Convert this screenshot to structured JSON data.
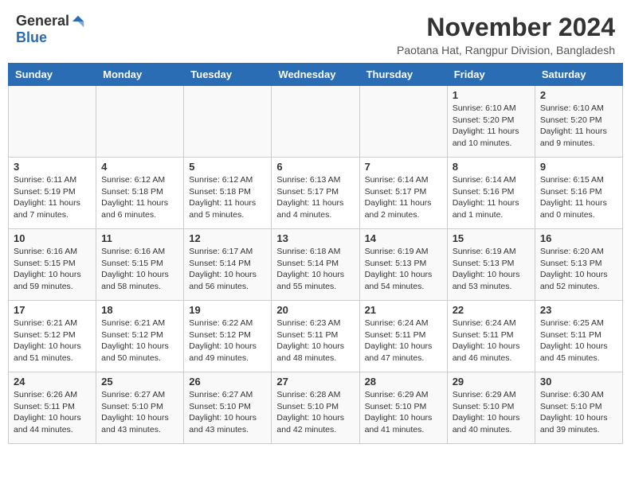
{
  "logo": {
    "general": "General",
    "blue": "Blue"
  },
  "header": {
    "month_title": "November 2024",
    "location": "Paotana Hat, Rangpur Division, Bangladesh"
  },
  "weekdays": [
    "Sunday",
    "Monday",
    "Tuesday",
    "Wednesday",
    "Thursday",
    "Friday",
    "Saturday"
  ],
  "weeks": [
    [
      {
        "day": "",
        "info": ""
      },
      {
        "day": "",
        "info": ""
      },
      {
        "day": "",
        "info": ""
      },
      {
        "day": "",
        "info": ""
      },
      {
        "day": "",
        "info": ""
      },
      {
        "day": "1",
        "info": "Sunrise: 6:10 AM\nSunset: 5:20 PM\nDaylight: 11 hours and 10 minutes."
      },
      {
        "day": "2",
        "info": "Sunrise: 6:10 AM\nSunset: 5:20 PM\nDaylight: 11 hours and 9 minutes."
      }
    ],
    [
      {
        "day": "3",
        "info": "Sunrise: 6:11 AM\nSunset: 5:19 PM\nDaylight: 11 hours and 7 minutes."
      },
      {
        "day": "4",
        "info": "Sunrise: 6:12 AM\nSunset: 5:18 PM\nDaylight: 11 hours and 6 minutes."
      },
      {
        "day": "5",
        "info": "Sunrise: 6:12 AM\nSunset: 5:18 PM\nDaylight: 11 hours and 5 minutes."
      },
      {
        "day": "6",
        "info": "Sunrise: 6:13 AM\nSunset: 5:17 PM\nDaylight: 11 hours and 4 minutes."
      },
      {
        "day": "7",
        "info": "Sunrise: 6:14 AM\nSunset: 5:17 PM\nDaylight: 11 hours and 2 minutes."
      },
      {
        "day": "8",
        "info": "Sunrise: 6:14 AM\nSunset: 5:16 PM\nDaylight: 11 hours and 1 minute."
      },
      {
        "day": "9",
        "info": "Sunrise: 6:15 AM\nSunset: 5:16 PM\nDaylight: 11 hours and 0 minutes."
      }
    ],
    [
      {
        "day": "10",
        "info": "Sunrise: 6:16 AM\nSunset: 5:15 PM\nDaylight: 10 hours and 59 minutes."
      },
      {
        "day": "11",
        "info": "Sunrise: 6:16 AM\nSunset: 5:15 PM\nDaylight: 10 hours and 58 minutes."
      },
      {
        "day": "12",
        "info": "Sunrise: 6:17 AM\nSunset: 5:14 PM\nDaylight: 10 hours and 56 minutes."
      },
      {
        "day": "13",
        "info": "Sunrise: 6:18 AM\nSunset: 5:14 PM\nDaylight: 10 hours and 55 minutes."
      },
      {
        "day": "14",
        "info": "Sunrise: 6:19 AM\nSunset: 5:13 PM\nDaylight: 10 hours and 54 minutes."
      },
      {
        "day": "15",
        "info": "Sunrise: 6:19 AM\nSunset: 5:13 PM\nDaylight: 10 hours and 53 minutes."
      },
      {
        "day": "16",
        "info": "Sunrise: 6:20 AM\nSunset: 5:13 PM\nDaylight: 10 hours and 52 minutes."
      }
    ],
    [
      {
        "day": "17",
        "info": "Sunrise: 6:21 AM\nSunset: 5:12 PM\nDaylight: 10 hours and 51 minutes."
      },
      {
        "day": "18",
        "info": "Sunrise: 6:21 AM\nSunset: 5:12 PM\nDaylight: 10 hours and 50 minutes."
      },
      {
        "day": "19",
        "info": "Sunrise: 6:22 AM\nSunset: 5:12 PM\nDaylight: 10 hours and 49 minutes."
      },
      {
        "day": "20",
        "info": "Sunrise: 6:23 AM\nSunset: 5:11 PM\nDaylight: 10 hours and 48 minutes."
      },
      {
        "day": "21",
        "info": "Sunrise: 6:24 AM\nSunset: 5:11 PM\nDaylight: 10 hours and 47 minutes."
      },
      {
        "day": "22",
        "info": "Sunrise: 6:24 AM\nSunset: 5:11 PM\nDaylight: 10 hours and 46 minutes."
      },
      {
        "day": "23",
        "info": "Sunrise: 6:25 AM\nSunset: 5:11 PM\nDaylight: 10 hours and 45 minutes."
      }
    ],
    [
      {
        "day": "24",
        "info": "Sunrise: 6:26 AM\nSunset: 5:11 PM\nDaylight: 10 hours and 44 minutes."
      },
      {
        "day": "25",
        "info": "Sunrise: 6:27 AM\nSunset: 5:10 PM\nDaylight: 10 hours and 43 minutes."
      },
      {
        "day": "26",
        "info": "Sunrise: 6:27 AM\nSunset: 5:10 PM\nDaylight: 10 hours and 43 minutes."
      },
      {
        "day": "27",
        "info": "Sunrise: 6:28 AM\nSunset: 5:10 PM\nDaylight: 10 hours and 42 minutes."
      },
      {
        "day": "28",
        "info": "Sunrise: 6:29 AM\nSunset: 5:10 PM\nDaylight: 10 hours and 41 minutes."
      },
      {
        "day": "29",
        "info": "Sunrise: 6:29 AM\nSunset: 5:10 PM\nDaylight: 10 hours and 40 minutes."
      },
      {
        "day": "30",
        "info": "Sunrise: 6:30 AM\nSunset: 5:10 PM\nDaylight: 10 hours and 39 minutes."
      }
    ]
  ]
}
